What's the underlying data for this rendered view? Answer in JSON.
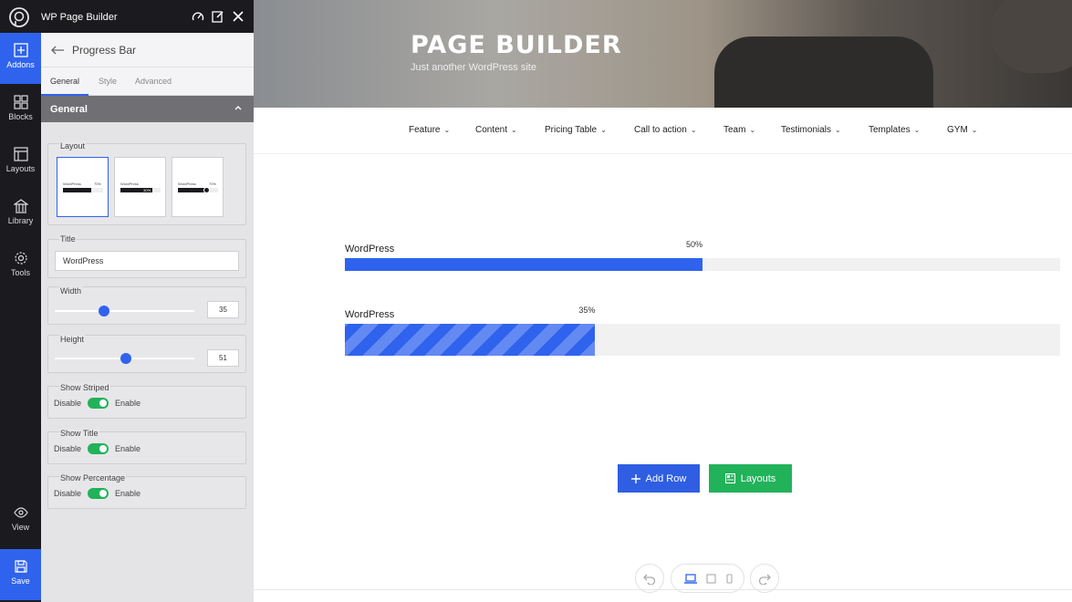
{
  "app": {
    "title": "WP Page Builder"
  },
  "rail": {
    "items": [
      {
        "label": "Addons",
        "icon": "plus-square-icon"
      },
      {
        "label": "Blocks",
        "icon": "blocks-icon"
      },
      {
        "label": "Layouts",
        "icon": "layouts-icon"
      },
      {
        "label": "Library",
        "icon": "library-icon"
      },
      {
        "label": "Tools",
        "icon": "gear-icon"
      },
      {
        "label": "View",
        "icon": "eye-icon"
      },
      {
        "label": "Save",
        "icon": "save-icon"
      }
    ]
  },
  "panel": {
    "heading": "Progress Bar",
    "tabs": [
      "General",
      "Style",
      "Advanced"
    ],
    "section": "General",
    "layout": {
      "label": "Layout",
      "cards": [
        {
          "title": "WordPress",
          "pct": "70%"
        },
        {
          "title": "WordPress",
          "pct": "30%"
        },
        {
          "title": "WordPress",
          "pct": "70%"
        }
      ]
    },
    "title_field": {
      "label": "Title",
      "value": "WordPress"
    },
    "width_field": {
      "label": "Width",
      "value": "35",
      "level": 0.35
    },
    "height_field": {
      "label": "Height",
      "value": "51",
      "level": 0.51
    },
    "toggles": [
      {
        "label": "Show Striped",
        "off": "Disable",
        "on": "Enable",
        "enabled": true
      },
      {
        "label": "Show Title",
        "off": "Disable",
        "on": "Enable",
        "enabled": true
      },
      {
        "label": "Show Percentage",
        "off": "Disable",
        "on": "Enable",
        "enabled": true
      }
    ]
  },
  "site": {
    "title": "PAGE BUILDER",
    "tagline": "Just another WordPress site"
  },
  "nav": {
    "items": [
      "Feature",
      "Content",
      "Pricing Table",
      "Call to action",
      "Team",
      "Testimonials",
      "Templates",
      "GYM"
    ]
  },
  "bars": [
    {
      "title": "WordPress",
      "pct_label": "50%",
      "value": 50,
      "striped": false
    },
    {
      "title": "WordPress",
      "pct_label": "35%",
      "value": 35,
      "striped": true
    }
  ],
  "buttons": {
    "add_row": "Add Row",
    "layouts": "Layouts"
  },
  "colors": {
    "accent": "#2f63ee",
    "success": "#21b25a",
    "sidebar_bg": "#1b1b1f"
  }
}
